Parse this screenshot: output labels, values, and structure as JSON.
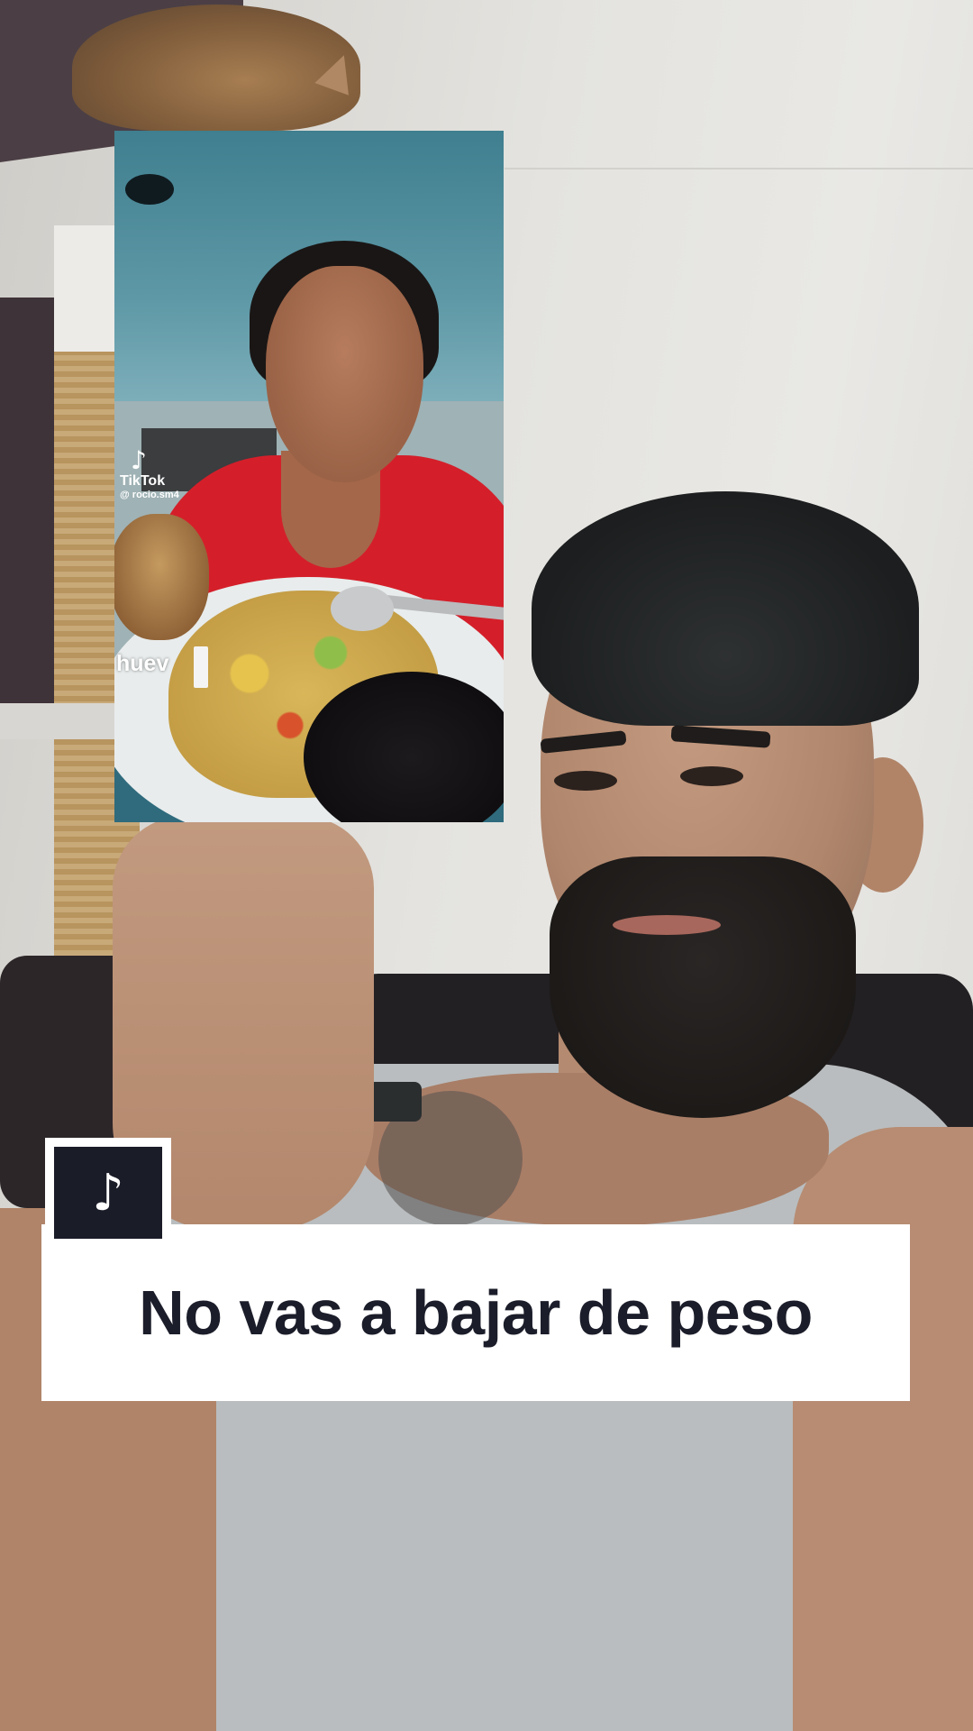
{
  "embedded_clip": {
    "platform_name": "TikTok",
    "username": "@ rocio.sm4",
    "logo_icon": "tiktok-logo-icon",
    "caption_fragment": "huev"
  },
  "badge": {
    "icon": "tiktok-logo-icon",
    "glyph": "♪"
  },
  "caption": {
    "text": "No vas a bajar de peso"
  },
  "colors": {
    "caption_text": "#1b1d2a",
    "badge_background": "#1a1c28",
    "caption_background": "#ffffff"
  }
}
